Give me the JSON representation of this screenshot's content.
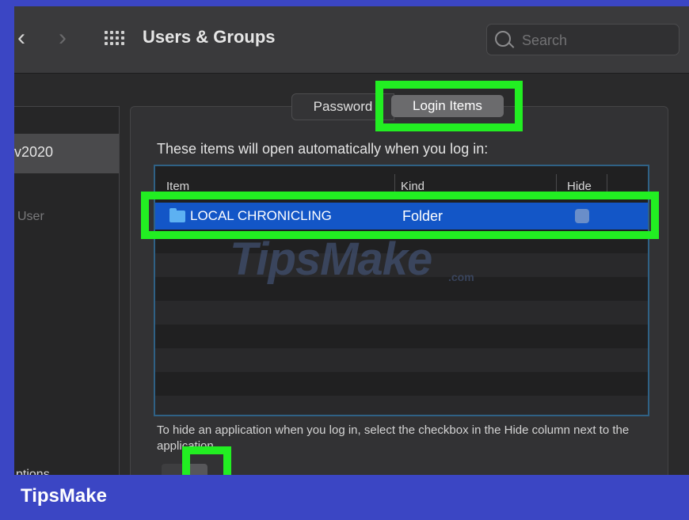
{
  "window": {
    "title": "Users & Groups",
    "search_placeholder": "Search"
  },
  "sidebar": {
    "selected_user": "v2020",
    "sub_label": "User",
    "bottom_label": "ptions"
  },
  "tabs": [
    {
      "label": "Password",
      "selected": false
    },
    {
      "label": "Login Items",
      "selected": true
    }
  ],
  "main": {
    "description": "These items will open automatically when you log in:",
    "columns": [
      "Item",
      "Kind",
      "Hide"
    ],
    "rows": [
      {
        "item": "LOCAL CHRONICLING",
        "kind": "Folder",
        "hide": false,
        "selected": true
      }
    ],
    "help_text": "To hide an application when you log in, select the checkbox in the Hide column next to the application."
  },
  "watermark": {
    "text": "TipsMake",
    "suffix": ".com"
  },
  "brand": {
    "label": "TipsMake"
  },
  "colors": {
    "highlight": "#22ee22",
    "brand_bar": "#3b46c4",
    "selection": "#1356c7"
  }
}
